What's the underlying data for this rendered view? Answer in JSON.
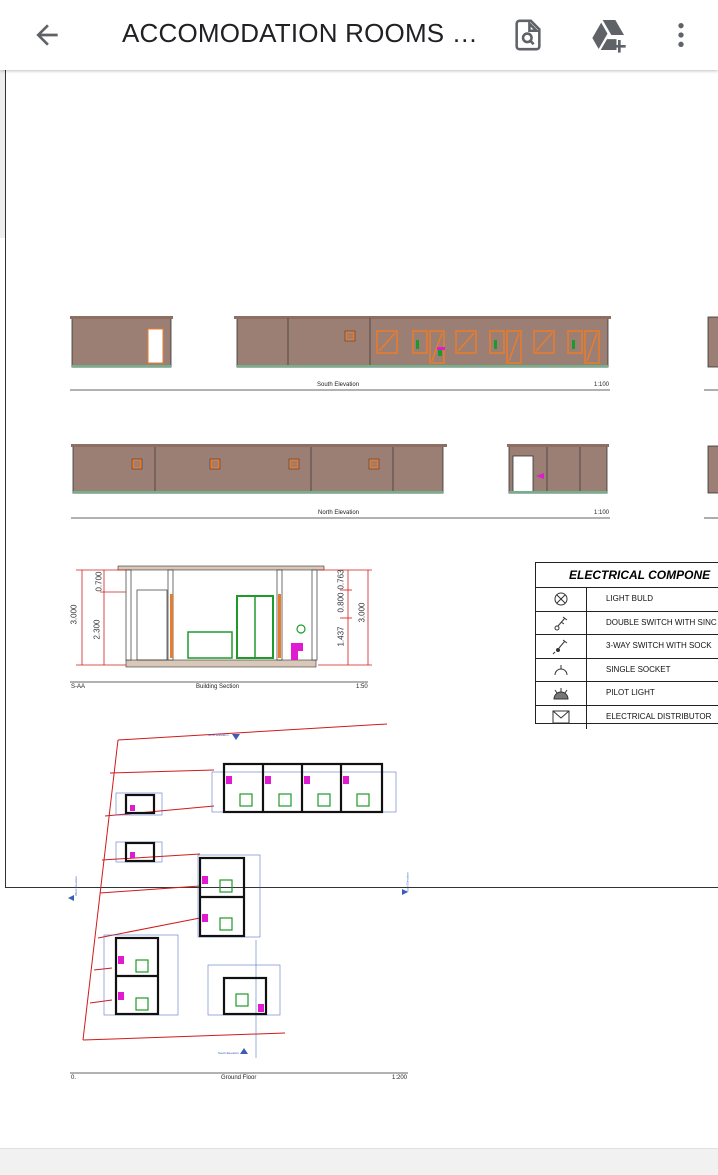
{
  "appbar": {
    "title": "ACCOMODATION ROOMS 0...",
    "back_icon": "arrow-back-icon",
    "find_icon": "find-in-page-icon",
    "drive_icon": "add-to-drive-icon",
    "menu_icon": "more-vert-icon"
  },
  "drawing": {
    "south_elevation": {
      "title": "South Elevation",
      "scale": "1:100"
    },
    "north_elevation": {
      "title": "North Elevation",
      "scale": "1:100"
    },
    "section": {
      "ref": "S-AA",
      "title": "Building Section",
      "scale": "1:50",
      "dims_left": {
        "total": "3.000",
        "top": "0.700",
        "bottom": "2.300"
      },
      "dims_right": {
        "total": "3.000",
        "upper": "0.763",
        "mid": "0.800",
        "lower": "1.437"
      }
    },
    "ground_floor": {
      "ref": "0.",
      "title": "Ground Floor",
      "scale": "1:200",
      "north_marker": "North Elevation",
      "south_marker": "South Elevation",
      "west_marker": "West Elevation",
      "east_marker": "East Elevation"
    }
  },
  "legend": {
    "heading": "ELECTRICAL COMPONE",
    "items": [
      {
        "label": "LIGHT BULD",
        "icon": "light-bulb-symbol-icon"
      },
      {
        "label": "DOUBLE SWITCH WITH SINC",
        "icon": "double-switch-symbol-icon"
      },
      {
        "label": "3-WAY SWITCH WITH SOCK",
        "icon": "three-way-switch-symbol-icon"
      },
      {
        "label": "SINGLE SOCKET",
        "icon": "single-socket-symbol-icon"
      },
      {
        "label": "PILOT LIGHT",
        "icon": "pilot-light-symbol-icon"
      },
      {
        "label": "ELECTRICAL DISTRIBUTOR",
        "icon": "electrical-distributor-symbol-icon"
      }
    ]
  },
  "colors": {
    "wall": "#9b7f74",
    "window": "#e87b2d",
    "ground_line": "#6fb38a",
    "dimension": "#d21a1a",
    "fixture_green": "#1f9a2a",
    "fixture_magenta": "#e01ad0",
    "grid_blue": "#3a5db8"
  }
}
